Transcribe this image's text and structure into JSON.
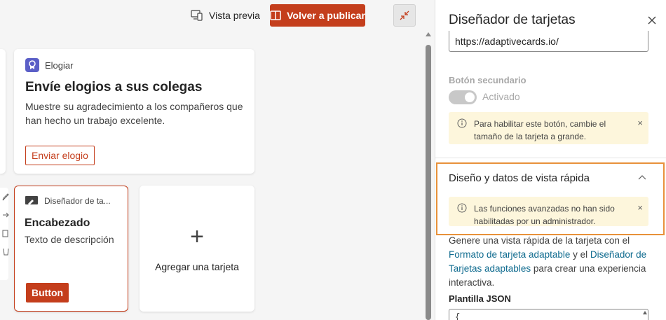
{
  "toolbar": {
    "preview_label": "Vista previa",
    "republish_label": "Volver a publicar"
  },
  "cards": {
    "praise": {
      "app_name": "Elogiar",
      "title": "Envíe elogios a sus colegas",
      "description": "Muestre su agradecimiento a los compañeros que han hecho un trabajo excelente.",
      "button": "Enviar elogio"
    },
    "designer": {
      "app_name": "Diseñador de ta...",
      "title": "Encabezado",
      "description": "Texto de descripción",
      "button": "Button"
    },
    "add": {
      "plus": "+",
      "label": "Agregar una tarjeta"
    }
  },
  "panel": {
    "title": "Diseñador de tarjetas",
    "url_value": "https://adaptivecards.io/",
    "secondary_button_label": "Botón secundario",
    "toggle_label": "Activado",
    "notice_1": "Para habilitar este botón, cambie el tamaño de la tarjeta a grande.",
    "section_title": "Diseño y datos de vista rápida",
    "notice_2": "Las funciones avanzadas no han sido habilitadas por un administrador.",
    "notice_close": "×",
    "body": {
      "part1": "Genere una vista rápida de la tarjeta con el ",
      "link1": "Formato de tarjeta adaptable",
      "part2": " y el ",
      "link2": "Diseñador de Tarjetas adaptables",
      "part3": " para crear una experiencia interactiva."
    },
    "json_label": "Plantilla JSON",
    "json_value": "{"
  },
  "colors": {
    "accent": "#c43e1c",
    "notice_bg": "#fdf6dc",
    "highlight": "#e8913a",
    "link": "#0f6b8f"
  }
}
